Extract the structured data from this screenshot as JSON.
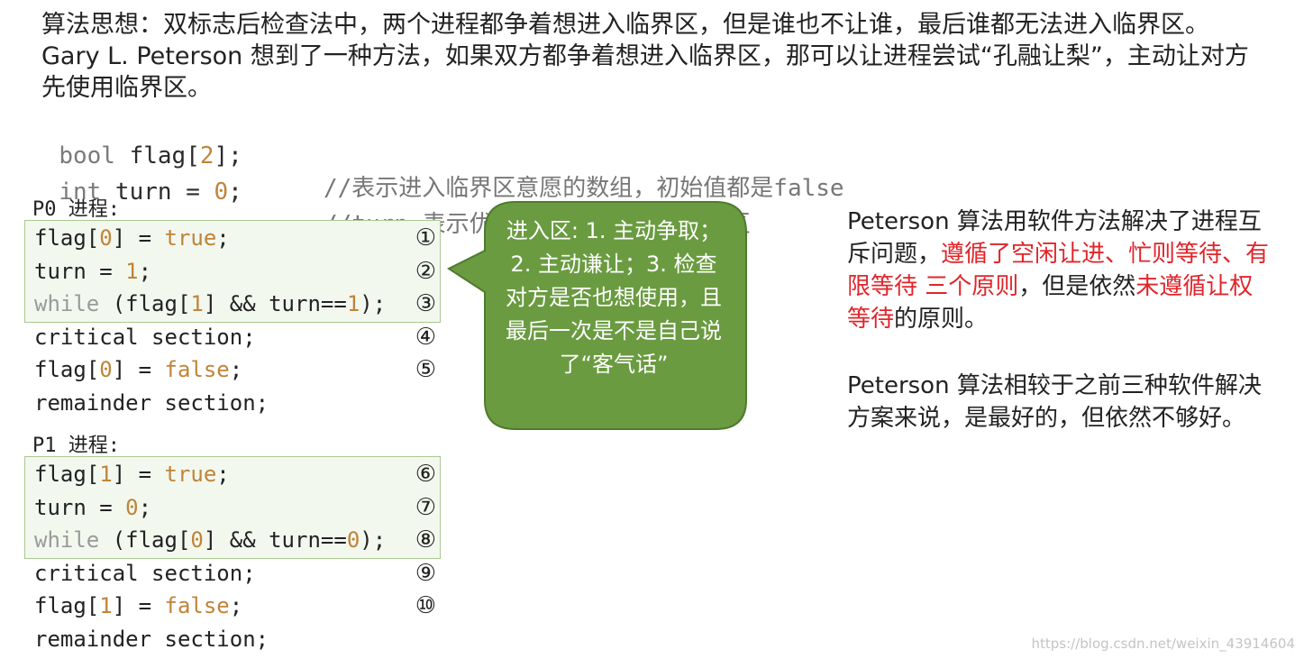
{
  "intro": {
    "text": "算法思想：双标志后检查法中，两个进程都争着想进入临界区，但是谁也不让谁，最后谁都无法进入临界区。Gary L. Peterson 想到了一种方法，如果双方都争着想进入临界区，那可以让进程尝试“孔融让梨”，主动让对方先使用临界区。"
  },
  "declarations": {
    "flag_type": "bool",
    "flag_name": " flag[",
    "flag_size": "2",
    "flag_end": "];",
    "flag_comment": "//表示进入临界区意愿的数组，初始值都是false",
    "turn_type": "int",
    "turn_name": " turn = ",
    "turn_init": "0",
    "turn_end": ";",
    "turn_comment": "//turn 表示优先让哪个进程进入临界区"
  },
  "p0": {
    "label": "P0 进程:",
    "lines": [
      {
        "pre": "flag[",
        "num": "0",
        "mid": "] = ",
        "lit": "true",
        "post": ";",
        "mark": "①"
      },
      {
        "pre": "turn = ",
        "num": "1",
        "post": ";",
        "mark": "②"
      },
      {
        "kw": "while",
        "pre": " (flag[",
        "num": "1",
        "mid": "] && turn==",
        "num2": "1",
        "post": ");",
        "mark": "③"
      },
      {
        "pre": "critical section;",
        "mark": "④"
      },
      {
        "pre": "flag[",
        "num": "0",
        "mid": "] = ",
        "lit": "false",
        "post": ";",
        "mark": "⑤"
      },
      {
        "pre": "remainder section;"
      }
    ]
  },
  "p1": {
    "label": "P1 进程:",
    "lines": [
      {
        "pre": "flag[",
        "num": "1",
        "mid": "] = ",
        "lit": "true",
        "post": ";",
        "mark": "⑥"
      },
      {
        "pre": "turn = ",
        "num": "0",
        "post": ";",
        "mark": "⑦"
      },
      {
        "kw": "while",
        "pre": " (flag[",
        "num": "0",
        "mid": "] && turn==",
        "num2": "0",
        "post": ");",
        "mark": "⑧"
      },
      {
        "pre": "critical section;",
        "mark": "⑨"
      },
      {
        "pre": "flag[",
        "num": "1",
        "mid": "] = ",
        "lit": "false",
        "post": ";",
        "mark": "⑩"
      },
      {
        "pre": "remainder section;"
      }
    ]
  },
  "callout": {
    "text": "进入区: 1. 主动争取；2. 主动谦让；3. 检查对方是否也想使用，且最后一次是不是自己说了“客气话”",
    "fill_color": "#6a9b40",
    "stroke_color": "#4f7a2e"
  },
  "side_note_1": {
    "part1": "Peterson 算法用软件方法解决了进程互斥问题，",
    "red1": "遵循了空闲让进、忙则等待、有限等待 三个原则",
    "part2": "，但是依然",
    "red2": "未遵循让权等待",
    "part3": "的原则。"
  },
  "side_note_2": {
    "text": "Peterson 算法相较于之前三种软件解决方案来说，是最好的，但依然不够好。"
  },
  "watermark": {
    "text": "https://blog.csdn.net/weixin_43914604"
  },
  "colors": {
    "accent_red": "#e0252a",
    "literal_orange": "#c0843a",
    "entry_box_border": "#a9c892"
  }
}
